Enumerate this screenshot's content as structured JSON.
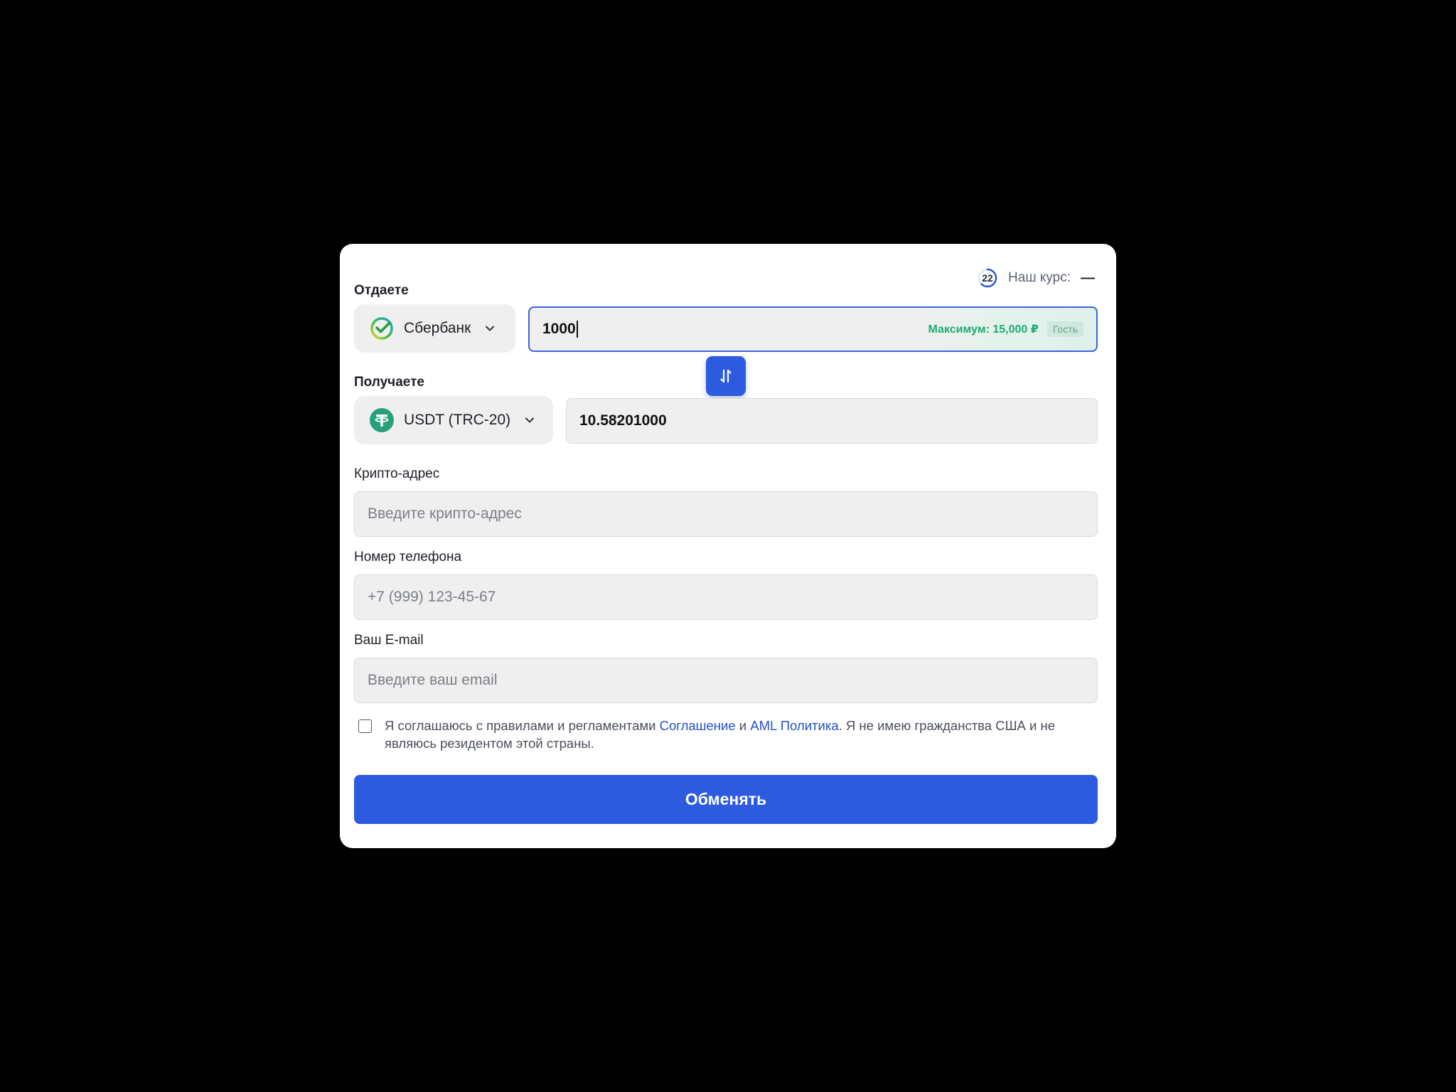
{
  "header": {
    "timer_value": "22",
    "rate_label": "Наш курс:",
    "rate_value": "—"
  },
  "give": {
    "label": "Отдаете",
    "currency": "Сбербанк",
    "currency_icon": "sberbank-logo-icon",
    "amount": "1000",
    "max_text": "Максимум: 15,000 ₽",
    "guest_badge": "Гость"
  },
  "receive": {
    "label": "Получаете",
    "currency": "USDT (TRC-20)",
    "currency_icon": "tether-logo-icon",
    "amount": "10.58201000"
  },
  "crypto_address": {
    "label": "Крипто-адрес",
    "placeholder": "Введите крипто-адрес"
  },
  "phone": {
    "label": "Номер телефона",
    "placeholder": "+7 (999) 123-45-67"
  },
  "email": {
    "label": "Ваш E-mail",
    "placeholder": "Введите ваш email"
  },
  "agreement": {
    "checked": false,
    "text_before": "Я соглашаюсь с правилами и регламентами ",
    "link1": "Соглашение",
    "text_mid": " и ",
    "link2": "AML Политика",
    "text_after": ". Я не имею гражданства США и не являюсь резидентом этой страны."
  },
  "submit_label": "Обменять",
  "colors": {
    "accent": "#2d5be0",
    "success": "#1fab74",
    "link": "#2451c9",
    "background": "#000000"
  }
}
